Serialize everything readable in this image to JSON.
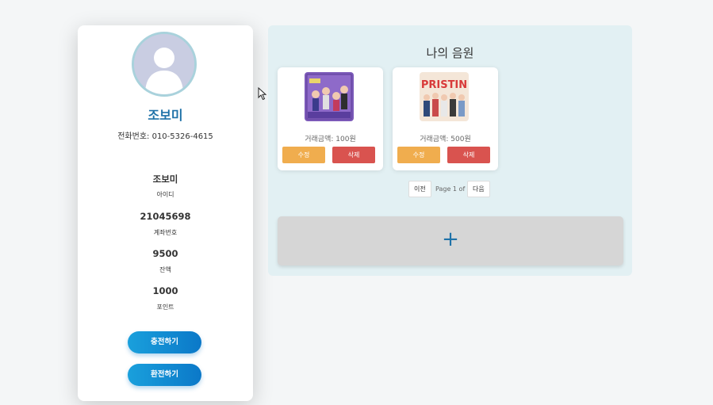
{
  "profile": {
    "name": "조보미",
    "phone_label": "전화번호:",
    "phone_value": "010-5326-4615",
    "stats": [
      {
        "value": "조보미",
        "label": "아이디"
      },
      {
        "value": "21045698",
        "label": "계좌번호"
      },
      {
        "value": "9500",
        "label": "잔액"
      },
      {
        "value": "1000",
        "label": "포인트"
      }
    ],
    "charge_button": "충전하기",
    "exchange_button": "환전하기"
  },
  "music": {
    "title": "나의 음원",
    "items": [
      {
        "price_label": "거래금액:",
        "price_value": "100원",
        "album_text": "",
        "edit_label": "수정",
        "delete_label": "삭제"
      },
      {
        "price_label": "거래금액:",
        "price_value": "500원",
        "album_text": "PRISTIN",
        "edit_label": "수정",
        "delete_label": "삭제"
      }
    ],
    "pagination": {
      "prev": "이전",
      "info": "Page 1 of",
      "next": "다음"
    },
    "add_symbol": "+"
  },
  "colors": {
    "accent_blue": "#1f72a8",
    "button_gradient_start": "#1aa0dc",
    "edit": "#f0ad4e",
    "delete": "#d9534f",
    "panel_bg": "#e2f0f3"
  }
}
